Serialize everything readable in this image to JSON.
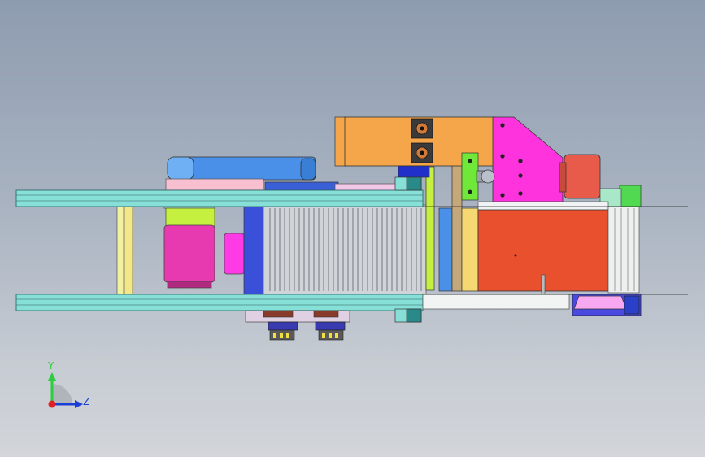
{
  "triad": {
    "y_label": "Y",
    "z_label": "Z",
    "y_color": "#2ecc40",
    "z_color": "#1a3fd6",
    "x_color": "#e02020"
  },
  "colors": {
    "background_top": "#8e9cb0",
    "background_bottom": "#d2d5da",
    "rail": "#87e0d8",
    "motor_bracket": "#f5a64a",
    "side_plate": "#ff33dd",
    "motor_red": "#e85a4a",
    "block_orange_red": "#e8502e",
    "blue_motor": "#4a90e8",
    "magenta_motor": "#e83ab0",
    "lime_block": "#c6f040",
    "belt_gray": "#d0d4d8",
    "green_block": "#52d952"
  }
}
